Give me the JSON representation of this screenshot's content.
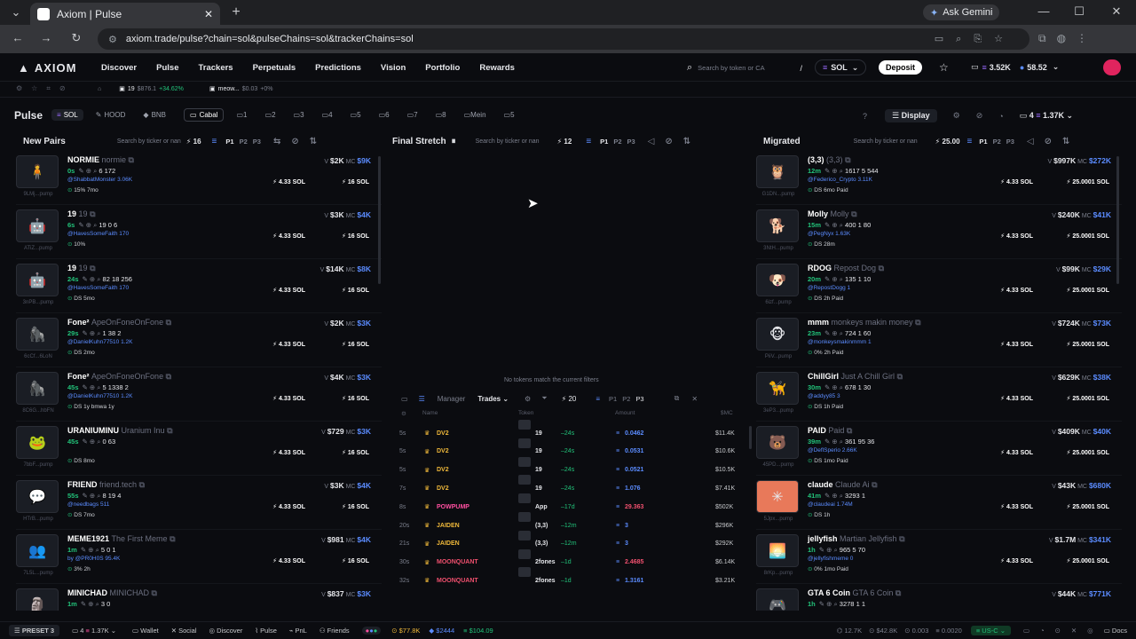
{
  "browser": {
    "tab_title": "Axiom | Pulse",
    "url": "axiom.trade/pulse?chain=sol&pulseChains=sol&trackerChains=sol",
    "ask_gemini": "Ask Gemini"
  },
  "nav": {
    "logo": "AXIOM",
    "items": [
      "Discover",
      "Pulse",
      "Trackers",
      "Perpetuals",
      "Predictions",
      "Vision",
      "Portfolio",
      "Rewards"
    ],
    "search_placeholder": "Search by token or CA",
    "search_shortcut": "/",
    "chain": "SOL",
    "deposit": "Deposit",
    "balance1": "3.52K",
    "balance2": "58.52"
  },
  "sub": {
    "ticker1": "19",
    "ticker1_price": "$876.1",
    "ticker1_change": "+34.62%",
    "ticker2": "meow...",
    "ticker2_price": "$0.03",
    "ticker2_change": "+0%"
  },
  "pulse": {
    "title": "Pulse",
    "chains": [
      "SOL",
      "HOOD",
      "BNB"
    ],
    "cabal": "Cabal",
    "filters": [
      "1",
      "2",
      "3",
      "4",
      "5",
      "6",
      "7",
      "8",
      "Mein",
      "5"
    ],
    "display": "Display",
    "count": "4",
    "vol": "1.37K"
  },
  "columns": {
    "new_pairs": {
      "title": "New Pairs",
      "search": "Search by ticker or nan",
      "count": "16",
      "pages": [
        "P1",
        "P2",
        "P3"
      ]
    },
    "final_stretch": {
      "title": "Final Stretch",
      "search": "Search by ticker or nan",
      "count": "12",
      "pages": [
        "P1",
        "P2",
        "P3"
      ],
      "empty": "No tokens match the current filters"
    },
    "migrated": {
      "title": "Migrated",
      "search": "Search by ticker or nan",
      "count": "25.00",
      "pages": [
        "P1",
        "P2",
        "P3"
      ]
    }
  },
  "new_pairs": [
    {
      "name": "NORMIE",
      "full": "normie",
      "age": "0s",
      "stats": "6  172",
      "user": "@ShabbatMonster  3.06K",
      "extra": "15%  7mo",
      "vol": "$2K",
      "mc": "$9K",
      "btn1": "4.33 SOL",
      "btn2": "16 SOL",
      "ca": "9LMj...pump",
      "emoji": "🧍"
    },
    {
      "name": "19",
      "full": "19",
      "age": "6s",
      "stats": "19  0  6",
      "user": "@HavesSomeFaith  170",
      "extra": "10%",
      "vol": "$3K",
      "mc": "$4K",
      "btn1": "4.33 SOL",
      "btn2": "16 SOL",
      "ca": "ATiZ...pump",
      "emoji": "🤖"
    },
    {
      "name": "19",
      "full": "19",
      "age": "24s",
      "stats": "82  18  256",
      "user": "@HavesSomeFaith  170",
      "extra": "DS  5mo",
      "vol": "$14K",
      "mc": "$8K",
      "btn1": "4.33 SOL",
      "btn2": "16 SOL",
      "ca": "3nPB...pump",
      "emoji": "🤖"
    },
    {
      "name": "Fone²",
      "full": "ApeOnFoneOnFone",
      "age": "29s",
      "stats": "1  38  2",
      "user": "@DanielKuhn77510  1.2K",
      "extra": "DS  2mo",
      "vol": "$2K",
      "mc": "$3K",
      "btn1": "4.33 SOL",
      "btn2": "16 SOL",
      "ca": "6cCf...6LoN",
      "emoji": "🦍"
    },
    {
      "name": "Fone²",
      "full": "ApeOnFoneOnFone",
      "age": "45s",
      "stats": "5  1338  2",
      "user": "@DanielKuhn77510  1.2K",
      "extra": "DS  1y  bmwa 1y",
      "vol": "$4K",
      "mc": "$3K",
      "btn1": "4.33 SOL",
      "btn2": "16 SOL",
      "ca": "8C6G...hbFN",
      "emoji": "🦍"
    },
    {
      "name": "URANIUMINU",
      "full": "Uranium Inu",
      "age": "45s",
      "stats": "0  63",
      "user": "",
      "extra": "DS  8mo",
      "vol": "$729",
      "mc": "$3K",
      "btn1": "4.33 SOL",
      "btn2": "16 SOL",
      "ca": "7bbF...pump",
      "emoji": "🐸"
    },
    {
      "name": "FRIEND",
      "full": "friend.tech",
      "age": "55s",
      "stats": "8  19  4",
      "user": "@needbags  511",
      "extra": "DS  7mo",
      "vol": "$3K",
      "mc": "$4K",
      "btn1": "4.33 SOL",
      "btn2": "16 SOL",
      "ca": "HTrB...pump",
      "emoji": "💬"
    },
    {
      "name": "MEME1921",
      "full": "The First Meme",
      "age": "1m",
      "stats": "5  0  1",
      "user": "by @PR0H0S  95.4K",
      "extra": "3%  2h",
      "vol": "$981",
      "mc": "$4K",
      "btn1": "4.33 SOL",
      "btn2": "16 SOL",
      "ca": "7L5L...pump",
      "emoji": "👥"
    },
    {
      "name": "MINICHAD",
      "full": "MINICHAD",
      "age": "1m",
      "stats": "3  0",
      "user": "",
      "extra": "",
      "vol": "$837",
      "mc": "$3K",
      "btn1": "",
      "btn2": "",
      "ca": "",
      "emoji": "🗿"
    }
  ],
  "migrated": [
    {
      "name": "(3,3)",
      "full": "(3,3)",
      "age": "12m",
      "stats": "1617  5  544",
      "user": "@Federico_Crypto  3.11K",
      "extra": "DS  6mo  Paid",
      "vol": "$997K",
      "mc": "$272K",
      "btn1": "4.33 SOL",
      "btn2": "25.0001 SOL",
      "ca": "G1DN...pump",
      "emoji": "🦉"
    },
    {
      "name": "Molly",
      "full": "Molly",
      "age": "15m",
      "stats": "400  1  80",
      "user": "@PegNyx  1.63K",
      "extra": "DS  28m",
      "vol": "$240K",
      "mc": "$41K",
      "btn1": "4.33 SOL",
      "btn2": "25.0001 SOL",
      "ca": "3NtH...pump",
      "emoji": "🐕"
    },
    {
      "name": "RDOG",
      "full": "Repost Dog",
      "age": "20m",
      "stats": "135  1  10",
      "user": "@RepostDogg  1",
      "extra": "DS  2h  Paid",
      "vol": "$99K",
      "mc": "$29K",
      "btn1": "4.33 SOL",
      "btn2": "25.0001 SOL",
      "ca": "6izf...pump",
      "emoji": "🐶"
    },
    {
      "name": "mmm",
      "full": "monkeys makin money",
      "age": "23m",
      "stats": "724  1  60",
      "user": "@monkeysmakinmmm  1",
      "extra": "0%  2h  Paid",
      "vol": "$724K",
      "mc": "$73K",
      "btn1": "4.33 SOL",
      "btn2": "25.0001 SOL",
      "ca": "PiiV...pump",
      "emoji": "🐵"
    },
    {
      "name": "ChillGirl",
      "full": "Just A Chill Girl",
      "age": "30m",
      "stats": "678  1  30",
      "user": "@addyy85  3",
      "extra": "DS  1h  Paid",
      "vol": "$629K",
      "mc": "$38K",
      "btn1": "4.33 SOL",
      "btn2": "25.0001 SOL",
      "ca": "3eP3...pump",
      "emoji": "🦮"
    },
    {
      "name": "PAID",
      "full": "Paid",
      "age": "39m",
      "stats": "361  95  36",
      "user": "@DeflSperio  2.66K",
      "extra": "DS  1mo  Paid",
      "vol": "$409K",
      "mc": "$40K",
      "btn1": "4.33 SOL",
      "btn2": "25.0001 SOL",
      "ca": "45PD...pump",
      "emoji": "🐻"
    },
    {
      "name": "claude",
      "full": "Claude Ai",
      "age": "41m",
      "stats": "3293  1",
      "user": "@claudeai  1.74M",
      "extra": "DS  1h",
      "vol": "$43K",
      "mc": "$680K",
      "btn1": "4.33 SOL",
      "btn2": "25.0001 SOL",
      "ca": "5Jpx...pump",
      "emoji": "✳"
    },
    {
      "name": "jellyfish",
      "full": "Martian Jellyfish",
      "age": "1h",
      "stats": "965  5  70",
      "user": "@jellyfishmeme  0",
      "extra": "0%  1mo  Paid",
      "vol": "$1.7M",
      "mc": "$341K",
      "btn1": "4.33 SOL",
      "btn2": "25.0001 SOL",
      "ca": "8rKp...pump",
      "emoji": "🌅"
    },
    {
      "name": "GTA 6 Coin",
      "full": "GTA 6 Coin",
      "age": "1h",
      "stats": "3278  1  1",
      "user": "",
      "extra": "",
      "vol": "$44K",
      "mc": "$771K",
      "btn1": "",
      "btn2": "",
      "ca": "",
      "emoji": "🎮"
    }
  ],
  "trades_panel": {
    "manager": "Manager",
    "trades": "Trades",
    "count": "20",
    "pages": [
      "P1",
      "P2",
      "P3"
    ],
    "headers": {
      "name": "Name",
      "token": "Token",
      "amount": "Amount",
      "mc": "$MC"
    },
    "rows": [
      {
        "t": "5s",
        "name": "DV2",
        "token": "19",
        "age": "24s",
        "amount": "0.0462",
        "mc": "$11.4K",
        "side": "buy",
        "name_color": "yellow"
      },
      {
        "t": "5s",
        "name": "DV2",
        "token": "19",
        "age": "24s",
        "amount": "0.0531",
        "mc": "$10.6K",
        "side": "buy",
        "name_color": "yellow"
      },
      {
        "t": "5s",
        "name": "DV2",
        "token": "19",
        "age": "24s",
        "amount": "0.0521",
        "mc": "$10.5K",
        "side": "buy",
        "name_color": "yellow"
      },
      {
        "t": "7s",
        "name": "DV2",
        "token": "19",
        "age": "24s",
        "amount": "1.076",
        "mc": "$7.41K",
        "side": "buy",
        "name_color": "yellow"
      },
      {
        "t": "8s",
        "name": "POWPUMP",
        "token": "App",
        "age": "17d",
        "amount": "29.363",
        "mc": "$502K",
        "side": "sell",
        "name_color": "pink"
      },
      {
        "t": "20s",
        "name": "JAIDEN",
        "token": "(3,3)",
        "age": "12m",
        "amount": "3",
        "mc": "$296K",
        "side": "buy",
        "name_color": "yellow"
      },
      {
        "t": "21s",
        "name": "JAIDEN",
        "token": "(3,3)",
        "age": "12m",
        "amount": "3",
        "mc": "$292K",
        "side": "buy",
        "name_color": "yellow"
      },
      {
        "t": "30s",
        "name": "MOONQUANT",
        "token": "2fones",
        "age": "1d",
        "amount": "2.4685",
        "mc": "$6.14K",
        "side": "sell",
        "name_color": "red"
      },
      {
        "t": "32s",
        "name": "MOONQUANT",
        "token": "2fones",
        "age": "1d",
        "amount": "1.3161",
        "mc": "$3.21K",
        "side": "buy",
        "name_color": "red"
      }
    ]
  },
  "bottom": {
    "preset": "PRESET 3",
    "count": "4",
    "vol": "1.37K",
    "items": [
      "Wallet",
      "Social",
      "Discover",
      "Pulse",
      "PnL",
      "Friends"
    ],
    "btc": "$77.8K",
    "eth": "$2444",
    "sol": "$104.09",
    "r1": "12.7K",
    "r2": "$42.8K",
    "r3": "0.003",
    "r4": "0.0020",
    "region": "US-C",
    "docs": "Docs"
  }
}
